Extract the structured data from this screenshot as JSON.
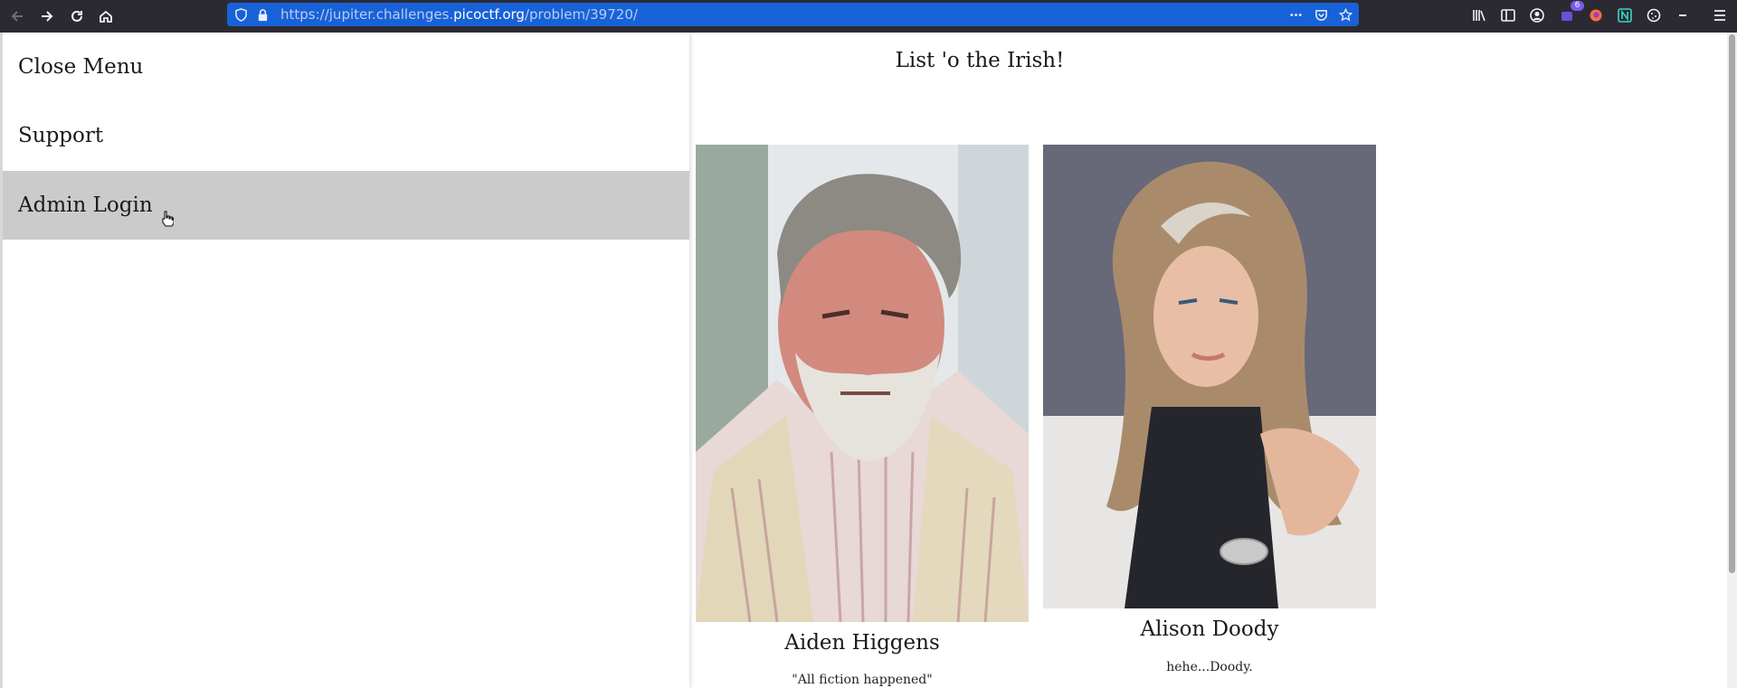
{
  "browser": {
    "url_prefix": "https://jupiter.challenges.",
    "url_host": "picoctf.org",
    "url_path": "/problem/39720/",
    "extension_badge": "6",
    "icons": [
      "back-icon",
      "forward-icon",
      "reload-icon",
      "home-icon",
      "shield-icon",
      "lock-icon",
      "more-icon",
      "pocket-icon",
      "bookmark-star-icon",
      "library-icon",
      "sidebar-icon",
      "account-icon",
      "extension-icon",
      "firefox-icon",
      "extension-n-icon",
      "cookie-icon",
      "minus-icon",
      "hamburger-menu-icon"
    ]
  },
  "sidenav": {
    "items": [
      {
        "label": "Close Menu"
      },
      {
        "label": "Support"
      },
      {
        "label": "Admin Login"
      }
    ]
  },
  "page": {
    "title": "List 'o the Irish!",
    "people": [
      {
        "name": "Aiden Higgens",
        "quote": "\"All fiction happened\""
      },
      {
        "name": "Alison Doody",
        "quote": "hehe...Doody."
      }
    ]
  },
  "colors": {
    "chrome_bg": "#2b2a33",
    "urlbar_bg": "#1862d8",
    "hover_bg": "#cbcbcb"
  }
}
